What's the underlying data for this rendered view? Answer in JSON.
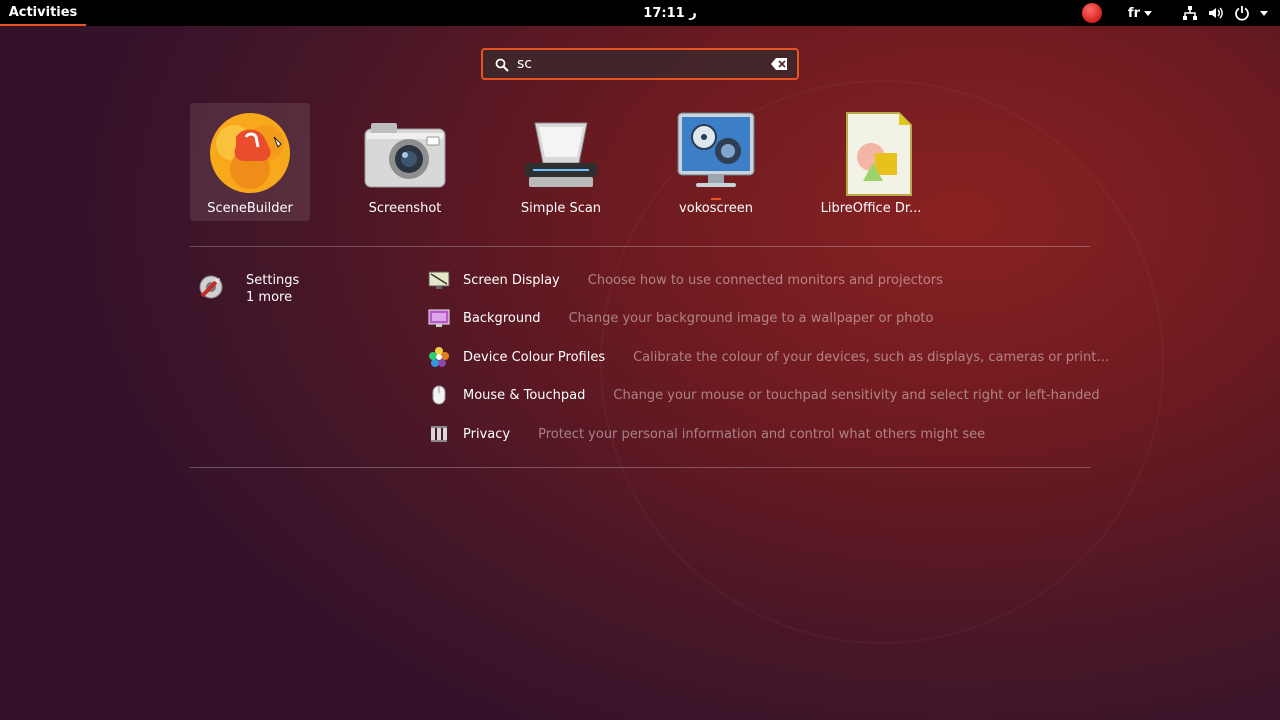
{
  "topbar": {
    "activities": "Activities",
    "clock": "17:11",
    "clock_suffix": "ﺭ",
    "language": "fr"
  },
  "search": {
    "value": "sc"
  },
  "apps": [
    {
      "label": "SceneBuilder",
      "icon": "scenebuilder-icon",
      "selected": true
    },
    {
      "label": "Screenshot",
      "icon": "camera-icon"
    },
    {
      "label": "Simple Scan",
      "icon": "scanner-icon"
    },
    {
      "label": "vokoscreen",
      "icon": "vokoscreen-icon",
      "running": true
    },
    {
      "label": "LibreOffice Dr...",
      "icon": "libreoffice-draw-icon"
    }
  ],
  "provider": {
    "name": "Settings",
    "more": "1 more",
    "icon": "settings-icon"
  },
  "results": [
    {
      "title": "Screen Display",
      "description": "Choose how to use connected monitors and projectors",
      "icon": "display-icon"
    },
    {
      "title": "Background",
      "description": "Change your background image to a wallpaper or photo",
      "icon": "background-icon"
    },
    {
      "title": "Device Colour Profiles",
      "description": "Calibrate the colour of your devices, such as displays, cameras or print…",
      "icon": "color-profile-icon"
    },
    {
      "title": "Mouse & Touchpad",
      "description": "Change your mouse or touchpad sensitivity and select right or left-handed",
      "icon": "mouse-icon"
    },
    {
      "title": "Privacy",
      "description": "Protect your personal information and control what others might see",
      "icon": "privacy-icon"
    }
  ],
  "colors": {
    "accent": "#e95420",
    "topbar": "#000000",
    "record": "#d62020"
  }
}
